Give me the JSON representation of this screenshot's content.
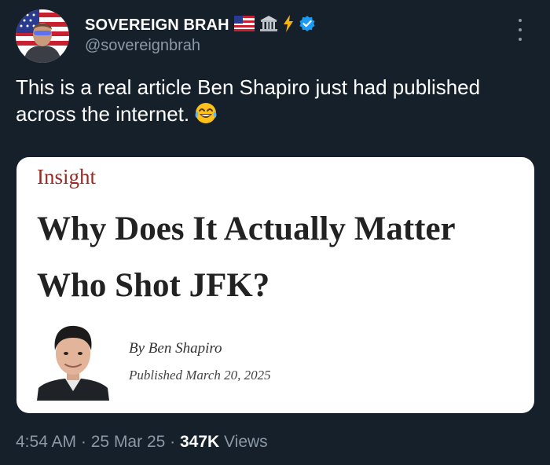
{
  "author": {
    "display_name": "SOVEREIGN BRAH",
    "handle": "@sovereignbrah",
    "name_emojis": [
      "us-flag-icon",
      "classical-building-icon",
      "lightning-icon"
    ],
    "verified": true,
    "avatar": "avatar-man-with-us-flag"
  },
  "tweet": {
    "text": "This is a real article Ben Shapiro just had published across the internet.",
    "trailing_emoji": "face-with-tears-of-joy-icon"
  },
  "article": {
    "section": "Insight",
    "headline": "Why Does It Actually Matter Who Shot JFK?",
    "byline": "By Ben Shapiro",
    "published": "Published March 20, 2025",
    "author_photo": "author-headshot"
  },
  "meta": {
    "time": "4:54 AM",
    "separator": "·",
    "date": "25 Mar 25",
    "views_count": "347K",
    "views_label": "Views"
  },
  "colors": {
    "background": "#15202b",
    "text_primary": "#ffffff",
    "text_secondary": "#8b98a5",
    "verified_badge": "#1d9bf0",
    "section_label": "#9a2a22"
  }
}
